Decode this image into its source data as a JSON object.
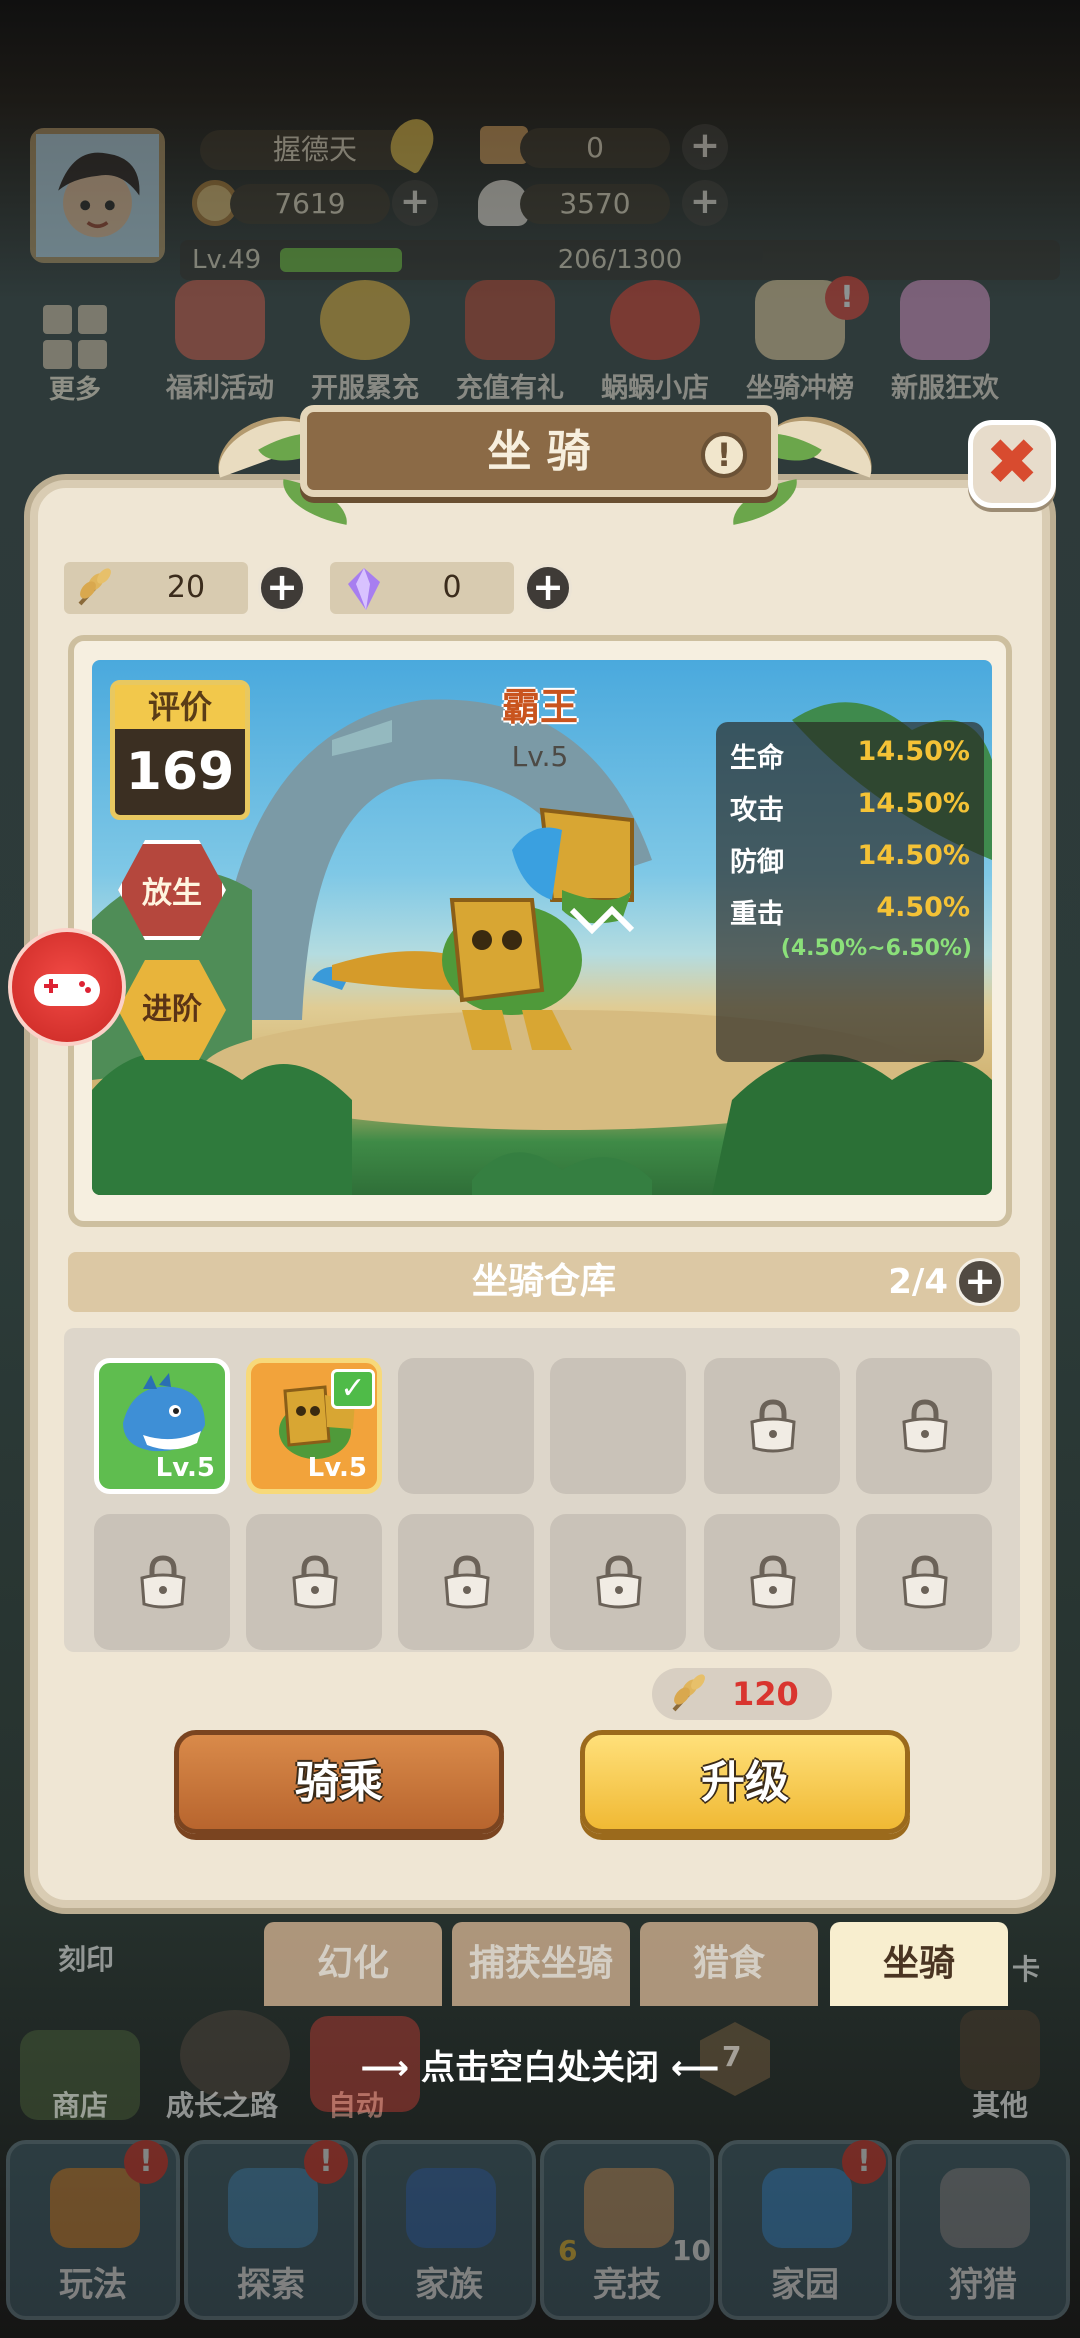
{
  "hud": {
    "player_name": "握德天",
    "res_ticket": "0",
    "res_coin": "7619",
    "res_shell": "3570",
    "level": "Lv.49",
    "xp": "206/1300",
    "xp_fraction": 0.158,
    "more_label": "更多"
  },
  "events": [
    "福利活动",
    "开服累充",
    "充值有礼",
    "蜗蜗小店",
    "坐骑冲榜",
    "新服狂欢"
  ],
  "panel": {
    "title": "坐 骑",
    "help_icon": "!",
    "close_icon": "✖",
    "wheat_count": "20",
    "crystal_count": "0"
  },
  "mount": {
    "rating_label": "评价",
    "rating_value": "169",
    "release_label": "放生",
    "advance_label": "进阶",
    "name": "霸王",
    "level": "Lv.5",
    "stats": [
      {
        "key": "生命",
        "value": "14.50%"
      },
      {
        "key": "攻击",
        "value": "14.50%"
      },
      {
        "key": "防御",
        "value": "14.50%"
      },
      {
        "key": "重击",
        "value": "4.50%"
      }
    ],
    "range_note": "(4.50%~6.50%)"
  },
  "warehouse": {
    "title": "坐骑仓库",
    "count": "2/4",
    "slots": [
      {
        "lv": "Lv.5"
      },
      {
        "lv": "Lv.5"
      }
    ]
  },
  "actions": {
    "cost": "120",
    "ride_label": "骑乘",
    "upgrade_label": "升级"
  },
  "subtabs": [
    "幻化",
    "捕获坐骑",
    "猎食",
    "坐骑"
  ],
  "hint": "点击空白处关闭",
  "bottom_labels": {
    "engrave": "刻印",
    "shop": "商店",
    "growth": "成长之路",
    "auto": "自动",
    "other": "其他",
    "card": "卡",
    "level_badge": "7"
  },
  "nav": [
    "玩法",
    "探索",
    "家族",
    "竞技",
    "家园",
    "狩猎"
  ],
  "nav_extras": {
    "a": "6",
    "b": "10"
  },
  "colors": {
    "ride_button": "#c9773b",
    "upgrade_button": "#f3c53c",
    "stat_value": "#f4c236",
    "mount_name": "#c9541e"
  }
}
